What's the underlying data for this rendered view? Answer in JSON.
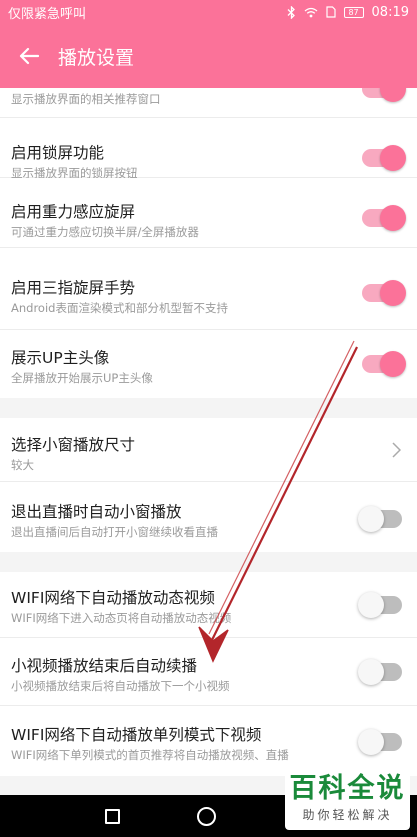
{
  "status_bar": {
    "left_text": "仅限紧急呼叫",
    "battery": "87",
    "time": "08:19"
  },
  "app_bar": {
    "title": "播放设置"
  },
  "settings": [
    {
      "title": "",
      "subtitle": "显示播放界面的相关推荐窗口",
      "control": "toggle",
      "state": "on"
    },
    {
      "title": "启用锁屏功能",
      "subtitle": "显示播放界面的锁屏按钮",
      "control": "toggle",
      "state": "on"
    },
    {
      "title": "启用重力感应旋屏",
      "subtitle": "可通过重力感应切换半屏/全屏播放器",
      "control": "toggle",
      "state": "on"
    },
    {
      "title": "启用三指旋屏手势",
      "subtitle": "Android表面渲染模式和部分机型暂不支持",
      "control": "toggle",
      "state": "on"
    },
    {
      "title": "展示UP主头像",
      "subtitle": "全屏播放开始展示UP主头像",
      "control": "toggle",
      "state": "on"
    },
    {
      "title": "选择小窗播放尺寸",
      "subtitle": "较大",
      "control": "chevron"
    },
    {
      "title": "退出直播时自动小窗播放",
      "subtitle": "退出直播间后自动打开小窗继续收看直播",
      "control": "toggle",
      "state": "off"
    },
    {
      "title": "WIFI网络下自动播放动态视频",
      "subtitle": "WIFI网络下进入动态页将自动播放动态视频",
      "control": "toggle",
      "state": "off"
    },
    {
      "title": "小视频播放结束后自动续播",
      "subtitle": "小视频播放结束后将自动播放下一个小视频",
      "control": "toggle",
      "state": "off"
    },
    {
      "title": "WIFI网络下自动播放单列模式下视频",
      "subtitle": "WIFI网络下单列模式的首页推荐将自动播放视频、直播",
      "control": "toggle",
      "state": "off"
    }
  ],
  "watermark": {
    "title": "百科全说",
    "subtitle": "助你轻松解决"
  },
  "colors": {
    "accent": "#fb7299",
    "annotation_arrow": "#b3262b"
  }
}
